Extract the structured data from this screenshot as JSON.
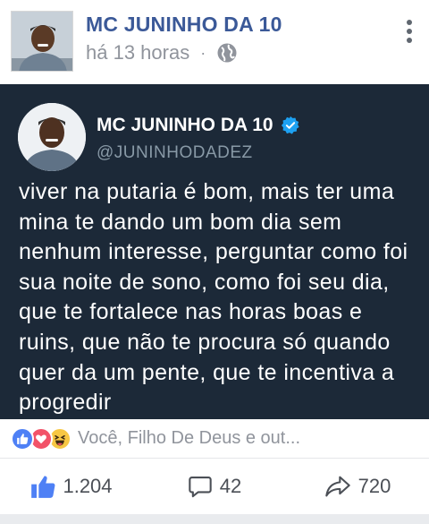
{
  "post": {
    "author": "MC JUNINHO DA 10",
    "time": "há 13 horas",
    "separator": "·",
    "privacy_icon": "globe-icon",
    "menu_icon": "more-vertical-icon"
  },
  "tweet": {
    "name": "MC JUNINHO DA 10",
    "handle": "@JUNINHODADEZ",
    "verified_icon": "verified-badge-icon",
    "text": "viver na putaria é bom, mais ter uma mina te dando um bom dia sem nenhum interesse, perguntar como foi sua noite de sono, como foi seu dia, que te fortalece nas horas boas e ruins, que não te procura só quando quer da um pente, que te incentiva a progredir",
    "background": "#1c2938"
  },
  "reactions": {
    "icons": [
      "like-reaction-icon",
      "love-reaction-icon",
      "haha-reaction-icon"
    ],
    "summary": "Você, Filho De Deus e out..."
  },
  "actions": {
    "likes": "1.204",
    "comments": "42",
    "shares": "720"
  },
  "colors": {
    "author": "#3b5998",
    "meta": "#90949c",
    "like_blue": "#4e80f5",
    "love_red": "#f25268",
    "haha_yellow": "#f7c744",
    "verified": "#1da1f2"
  }
}
